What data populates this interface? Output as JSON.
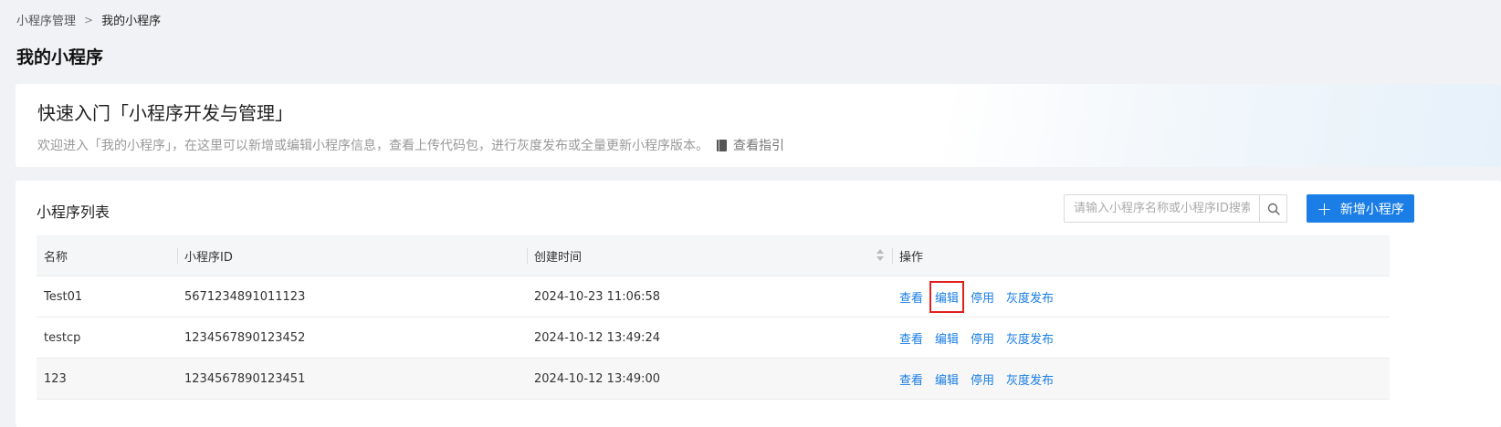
{
  "breadcrumb": {
    "parent": "小程序管理",
    "separator": ">",
    "current": "我的小程序"
  },
  "page": {
    "title": "我的小程序"
  },
  "guide": {
    "title": "快速入门「小程序开发与管理」",
    "description": "欢迎进入「我的小程序」，在这里可以新增或编辑小程序信息，查看上传代码包，进行灰度发布或全量更新小程序版本。",
    "link_label": "查看指引"
  },
  "list": {
    "title": "小程序列表",
    "search_placeholder": "请输入小程序名称或小程序ID搜索",
    "search_value": "",
    "add_button_label": "新增小程序",
    "columns": [
      "名称",
      "小程序ID",
      "创建时间",
      "操作"
    ],
    "rows": [
      {
        "name": "Test01",
        "id": "5671234891011123",
        "created": "2024-10-23 11:06:58"
      },
      {
        "name": "testcp",
        "id": "1234567890123452",
        "created": "2024-10-12 13:49:24"
      },
      {
        "name": "123",
        "id": "1234567890123451",
        "created": "2024-10-12 13:49:00"
      }
    ],
    "actions": {
      "view": "查看",
      "edit": "编辑",
      "disable": "停用",
      "gray_release": "灰度发布"
    }
  },
  "colors": {
    "accent": "#1a7ee6",
    "highlight": "#e02020"
  }
}
